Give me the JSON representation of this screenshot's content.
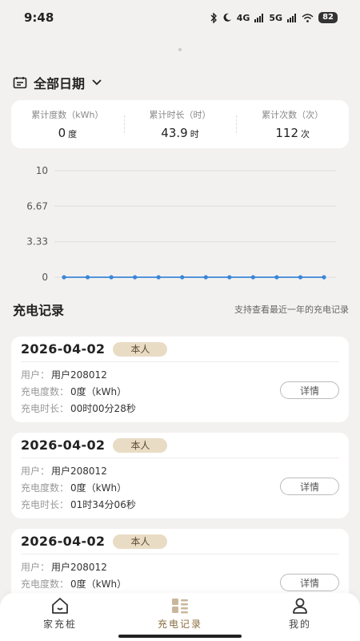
{
  "status_bar": {
    "time": "9:48",
    "icons": [
      "bluetooth-icon",
      "moon-icon",
      "signal-4g-icon",
      "signal-5g-icon",
      "wifi-icon"
    ],
    "net1": "4G",
    "net2": "5G",
    "battery": "82"
  },
  "date_filter": {
    "label": "全部日期"
  },
  "summary": {
    "energy_label": "累计度数（kWh）",
    "energy_value": "0",
    "energy_unit": "度",
    "duration_label": "累计时长（时）",
    "duration_value": "43.9",
    "duration_unit": "时",
    "count_label": "累计次数（次）",
    "count_value": "112",
    "count_unit": "次"
  },
  "chart_data": {
    "type": "line",
    "y_ticks": [
      "10",
      "6.67",
      "3.33",
      "0"
    ],
    "ylim": [
      0,
      10
    ],
    "values": [
      0,
      0,
      0,
      0,
      0,
      0,
      0,
      0,
      0,
      0,
      0,
      0
    ],
    "grid": true,
    "colors": {
      "line": "#3a86d9",
      "grid": "#dddddd"
    }
  },
  "records_section": {
    "title": "充电记录",
    "hint": "支持查看最近一年的充电记录"
  },
  "records": [
    {
      "date": "2026-04-02",
      "badge": "本人",
      "user_label": "用户：",
      "user": "用户208012",
      "energy_label": "充电度数：",
      "energy": "0度（kWh）",
      "duration_label": "充电时长：",
      "duration": "00时00分28秒",
      "detail": "详情"
    },
    {
      "date": "2026-04-02",
      "badge": "本人",
      "user_label": "用户：",
      "user": "用户208012",
      "energy_label": "充电度数：",
      "energy": "0度（kWh）",
      "duration_label": "充电时长：",
      "duration": "01时34分06秒",
      "detail": "详情"
    },
    {
      "date": "2026-04-02",
      "badge": "本人",
      "user_label": "用户：",
      "user": "用户208012",
      "energy_label": "充电度数：",
      "energy": "0度（kWh）",
      "detail": "详情"
    }
  ],
  "tab_bar": {
    "tabs": [
      {
        "label": "家充桩",
        "icon": "home-icon",
        "active": false
      },
      {
        "label": "充电记录",
        "icon": "records-icon",
        "active": true
      },
      {
        "label": "我的",
        "icon": "person-icon",
        "active": false
      }
    ]
  },
  "colors": {
    "accent": "#8a6d3f",
    "badge_bg": "#e9dcc5",
    "page_bg": "#f3f1ef"
  }
}
